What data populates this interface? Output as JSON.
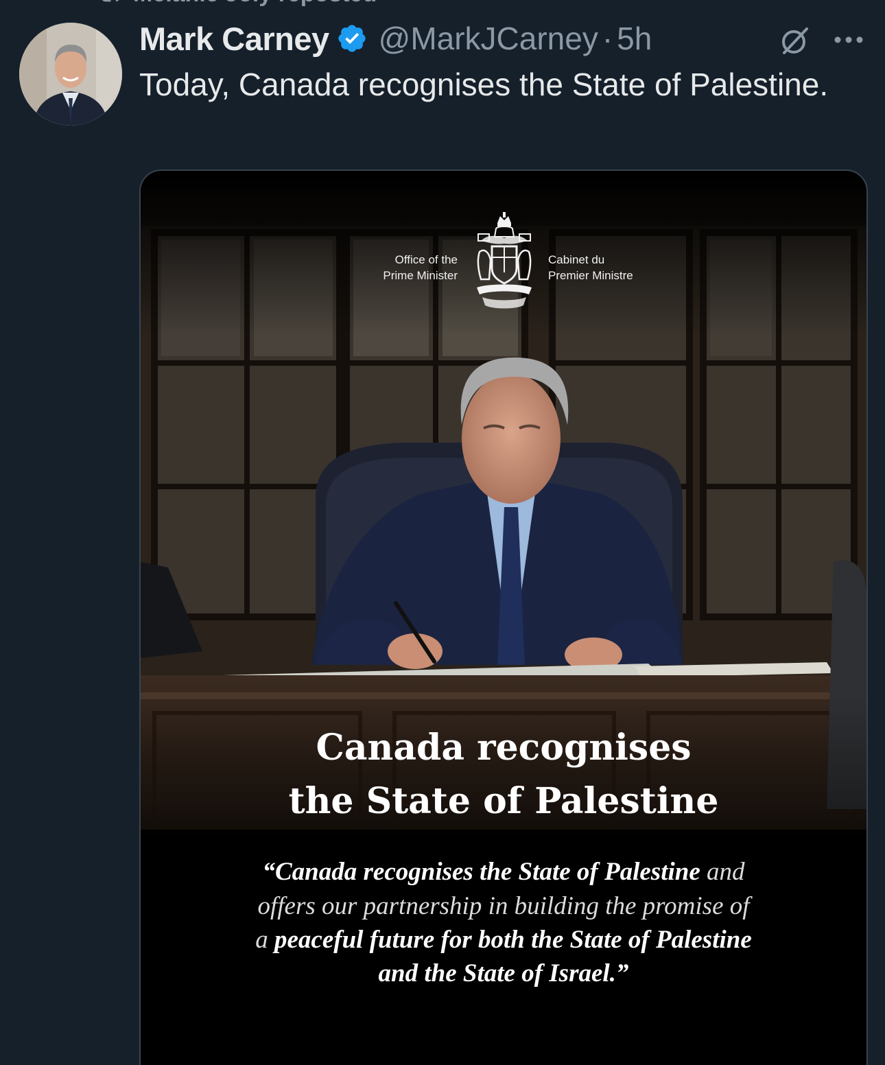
{
  "repost": {
    "label": "Mélanie Joly reposted"
  },
  "tweet": {
    "display_name": "Mark Carney",
    "handle": "@MarkJCarney",
    "separator": "·",
    "time": "5h",
    "text": "Today, Canada recognises the State of Palestine."
  },
  "media": {
    "office_en_line1": "Office of the",
    "office_en_line2": "Prime Minister",
    "office_fr_line1": "Cabinet du",
    "office_fr_line2": "Premier Ministre",
    "headline_line1": "Canada recognises",
    "headline_line2": "the State of Palestine",
    "quote": {
      "line1_bold": "“Canada recognises the State of Palestine",
      "line1_regular": " and",
      "line2_regular": "offers our partnership in building the promise of",
      "line3_regular": "a ",
      "line3_bold": "peaceful future for both the State of Palestine",
      "line4_bold": "and the State of Israel.”"
    }
  },
  "icons": {
    "verified": "verified-badge-icon",
    "grok": "grok-icon",
    "more": "more-options-icon",
    "repost": "repost-icon"
  },
  "colors": {
    "background": "#15202b",
    "secondary_text": "#8b98a5",
    "verified_blue": "#1d9bf0",
    "border": "#38444d"
  }
}
